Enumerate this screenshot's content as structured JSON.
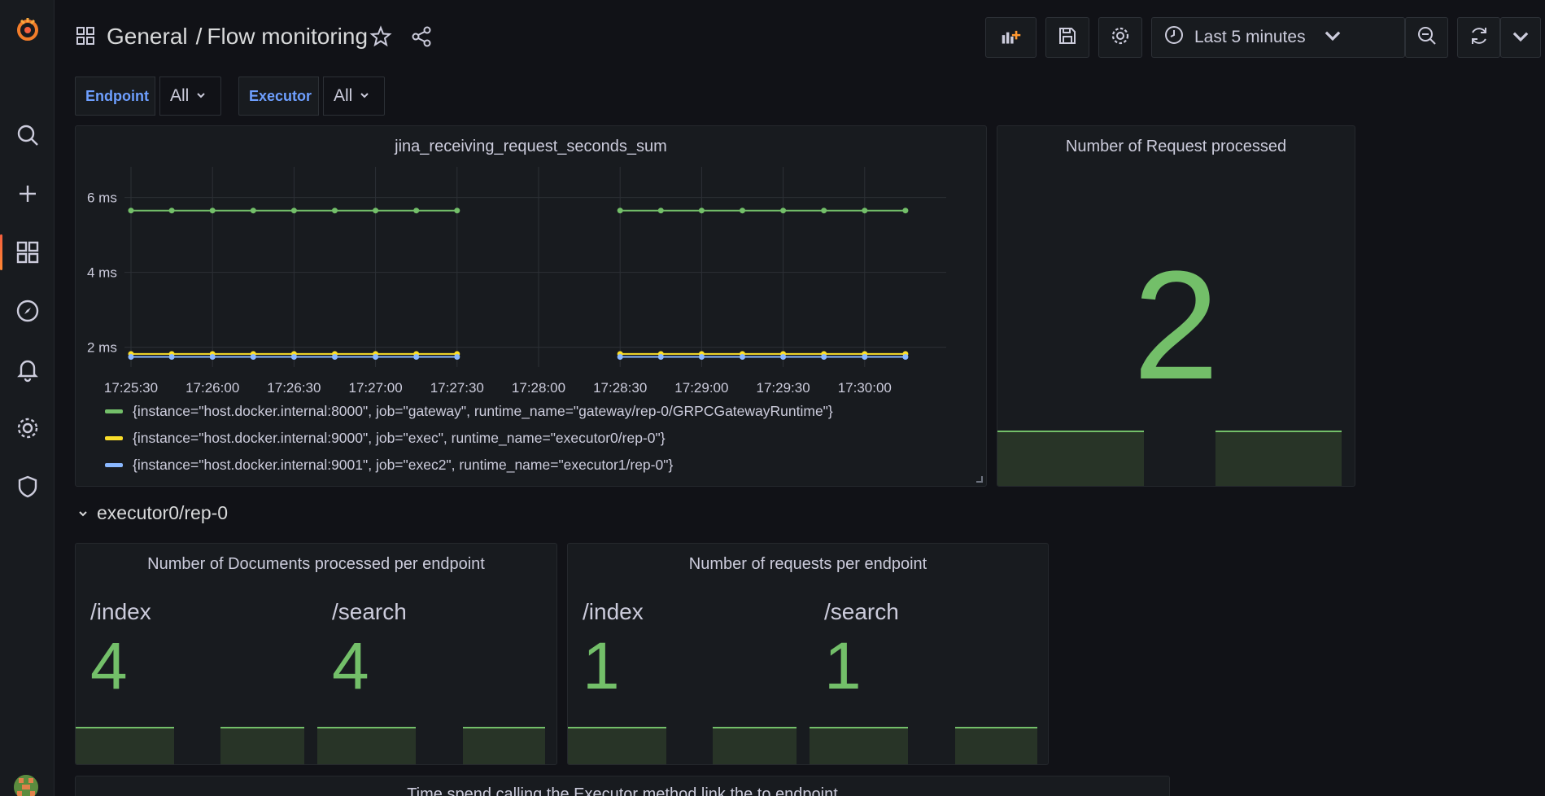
{
  "breadcrumb": {
    "folder": "General",
    "separator": "/",
    "dashboard": "Flow monitoring"
  },
  "toolbar": {
    "time_range": "Last 5 minutes"
  },
  "variables": [
    {
      "label": "Endpoint",
      "value": "All"
    },
    {
      "label": "Executor",
      "value": "All"
    }
  ],
  "panels": {
    "timeseries": {
      "title": "jina_receiving_request_seconds_sum",
      "legend": [
        {
          "text": "{instance=\"host.docker.internal:8000\", job=\"gateway\", runtime_name=\"gateway/rep-0/GRPCGatewayRuntime\"}",
          "color": "#73bf69"
        },
        {
          "text": "{instance=\"host.docker.internal:9000\", job=\"exec\", runtime_name=\"executor0/rep-0\"}",
          "color": "#fade2a"
        },
        {
          "text": "{instance=\"host.docker.internal:9001\", job=\"exec2\", runtime_name=\"executor1/rep-0\"}",
          "color": "#8ab8ff"
        }
      ]
    },
    "requests_total": {
      "title": "Number of Request processed",
      "value": "2"
    },
    "row": {
      "title": "executor0/rep-0"
    },
    "docs_per_endpoint": {
      "title": "Number of Documents processed per endpoint",
      "stats": [
        {
          "label": "/index",
          "value": "4"
        },
        {
          "label": "/search",
          "value": "4"
        }
      ]
    },
    "requests_per_endpoint": {
      "title": "Number of requests per endpoint",
      "stats": [
        {
          "label": "/index",
          "value": "1"
        },
        {
          "label": "/search",
          "value": "1"
        }
      ]
    },
    "time_spend": {
      "title": "Time spend calling the Executor method link the to endpoint"
    }
  },
  "chart_data": {
    "type": "line",
    "title": "jina_receiving_request_seconds_sum",
    "y_ticks": [
      "2 ms",
      "4 ms",
      "6 ms"
    ],
    "x_ticks": [
      "17:25:30",
      "17:26:00",
      "17:26:30",
      "17:27:00",
      "17:27:30",
      "17:28:00",
      "17:28:30",
      "17:29:00",
      "17:29:30",
      "17:30:00"
    ],
    "ylim_ms": [
      1.6,
      6.6
    ],
    "x": [
      "17:25:30",
      "17:25:45",
      "17:26:00",
      "17:26:15",
      "17:26:30",
      "17:26:45",
      "17:27:00",
      "17:27:15",
      "17:27:30",
      "17:28:30",
      "17:28:45",
      "17:29:00",
      "17:29:15",
      "17:29:30",
      "17:29:45",
      "17:30:00",
      "17:30:15"
    ],
    "series": [
      {
        "name": "{instance=\"host.docker.internal:8000\", job=\"gateway\", runtime_name=\"gateway/rep-0/GRPCGatewayRuntime\"}",
        "color": "#73bf69",
        "values": [
          5.65,
          5.65,
          5.65,
          5.65,
          5.65,
          5.65,
          5.65,
          5.65,
          5.65,
          5.65,
          5.65,
          5.65,
          5.65,
          5.65,
          5.65,
          5.65,
          5.65
        ]
      },
      {
        "name": "{instance=\"host.docker.internal:9000\", job=\"exec\", runtime_name=\"executor0/rep-0\"}",
        "color": "#fade2a",
        "values": [
          1.82,
          1.82,
          1.82,
          1.82,
          1.82,
          1.82,
          1.82,
          1.82,
          1.82,
          1.82,
          1.82,
          1.82,
          1.82,
          1.82,
          1.82,
          1.82,
          1.82
        ]
      },
      {
        "name": "{instance=\"host.docker.internal:9001\", job=\"exec2\", runtime_name=\"executor1/rep-0\"}",
        "color": "#8ab8ff",
        "values": [
          1.74,
          1.74,
          1.74,
          1.74,
          1.74,
          1.74,
          1.74,
          1.74,
          1.74,
          1.74,
          1.74,
          1.74,
          1.74,
          1.74,
          1.74,
          1.74,
          1.74
        ]
      }
    ],
    "grid": true
  }
}
